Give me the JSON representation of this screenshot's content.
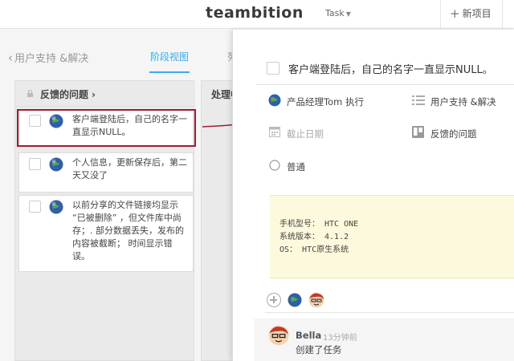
{
  "header": {
    "logo": "teambition",
    "task_menu": "Task",
    "new_project": "新项目"
  },
  "breadcrumb": {
    "back_label": "用户支持 &解决",
    "tab_stage": "阶段视图",
    "tab_other": "列"
  },
  "stages": [
    {
      "title": "反馈的问题",
      "cards": [
        {
          "text": "客户端登陆后，自己的名字一直显示NULL。"
        },
        {
          "text": "个人信息，更新保存后，第二天又没了"
        },
        {
          "text": "以前分享的文件链接均显示 “已被删除” ，但文件库中尚存；. 部分数据丢失，发布的内容被截断； 时间显示错误。"
        }
      ]
    },
    {
      "title": "处理中"
    }
  ],
  "detail": {
    "title": "客户端登陆后，自己的名字一直显示NULL。",
    "executor": "产品经理Tom 执行",
    "project": "用户支持 &解决",
    "due_placeholder": "截止日期",
    "stage": "反馈的问题",
    "priority": "普通",
    "note_lines": [
      "手机型号： HTC ONE",
      "系统版本： 4.1.2",
      "OS： HTC原生系统"
    ],
    "comment": {
      "user": "Bella",
      "time": "13分钟前",
      "text": "创建了任务"
    }
  },
  "colors": {
    "accent": "#3da8f5",
    "highlight": "#9b1f2e",
    "note_bg": "#fdf9dc"
  }
}
